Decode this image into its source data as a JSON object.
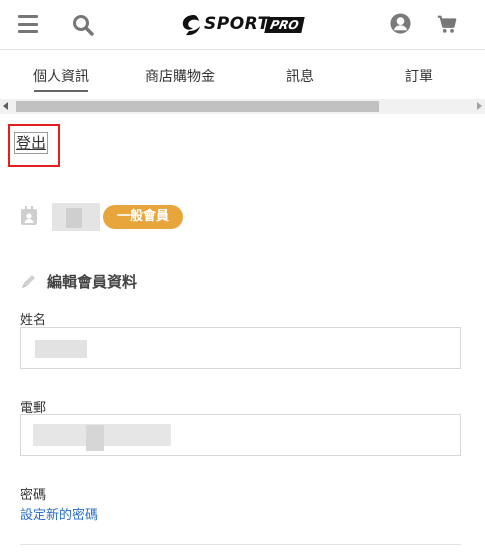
{
  "header": {
    "menu_icon": "hamburger-menu-icon",
    "search_icon": "search-icon",
    "logo_text": "SPORT",
    "logo_pro": "PRO",
    "account_icon": "user-account-icon",
    "cart_icon": "shopping-cart-icon"
  },
  "tabs": [
    {
      "label": "個人資訊",
      "active": true
    },
    {
      "label": "商店購物金",
      "active": false
    },
    {
      "label": "訊息",
      "active": false
    },
    {
      "label": "訂單",
      "active": false
    }
  ],
  "logout_label": "登出",
  "member": {
    "badge_label": "一般會員",
    "badge_color": "#e8a53c"
  },
  "profile": {
    "section_title": "編輯會員資料",
    "name_label": "姓名",
    "phone_label": "電郵",
    "password_label": "密碼",
    "set_password_link": "設定新的密碼"
  },
  "colors": {
    "highlight": "#e32020",
    "link": "#2a6fc9"
  }
}
